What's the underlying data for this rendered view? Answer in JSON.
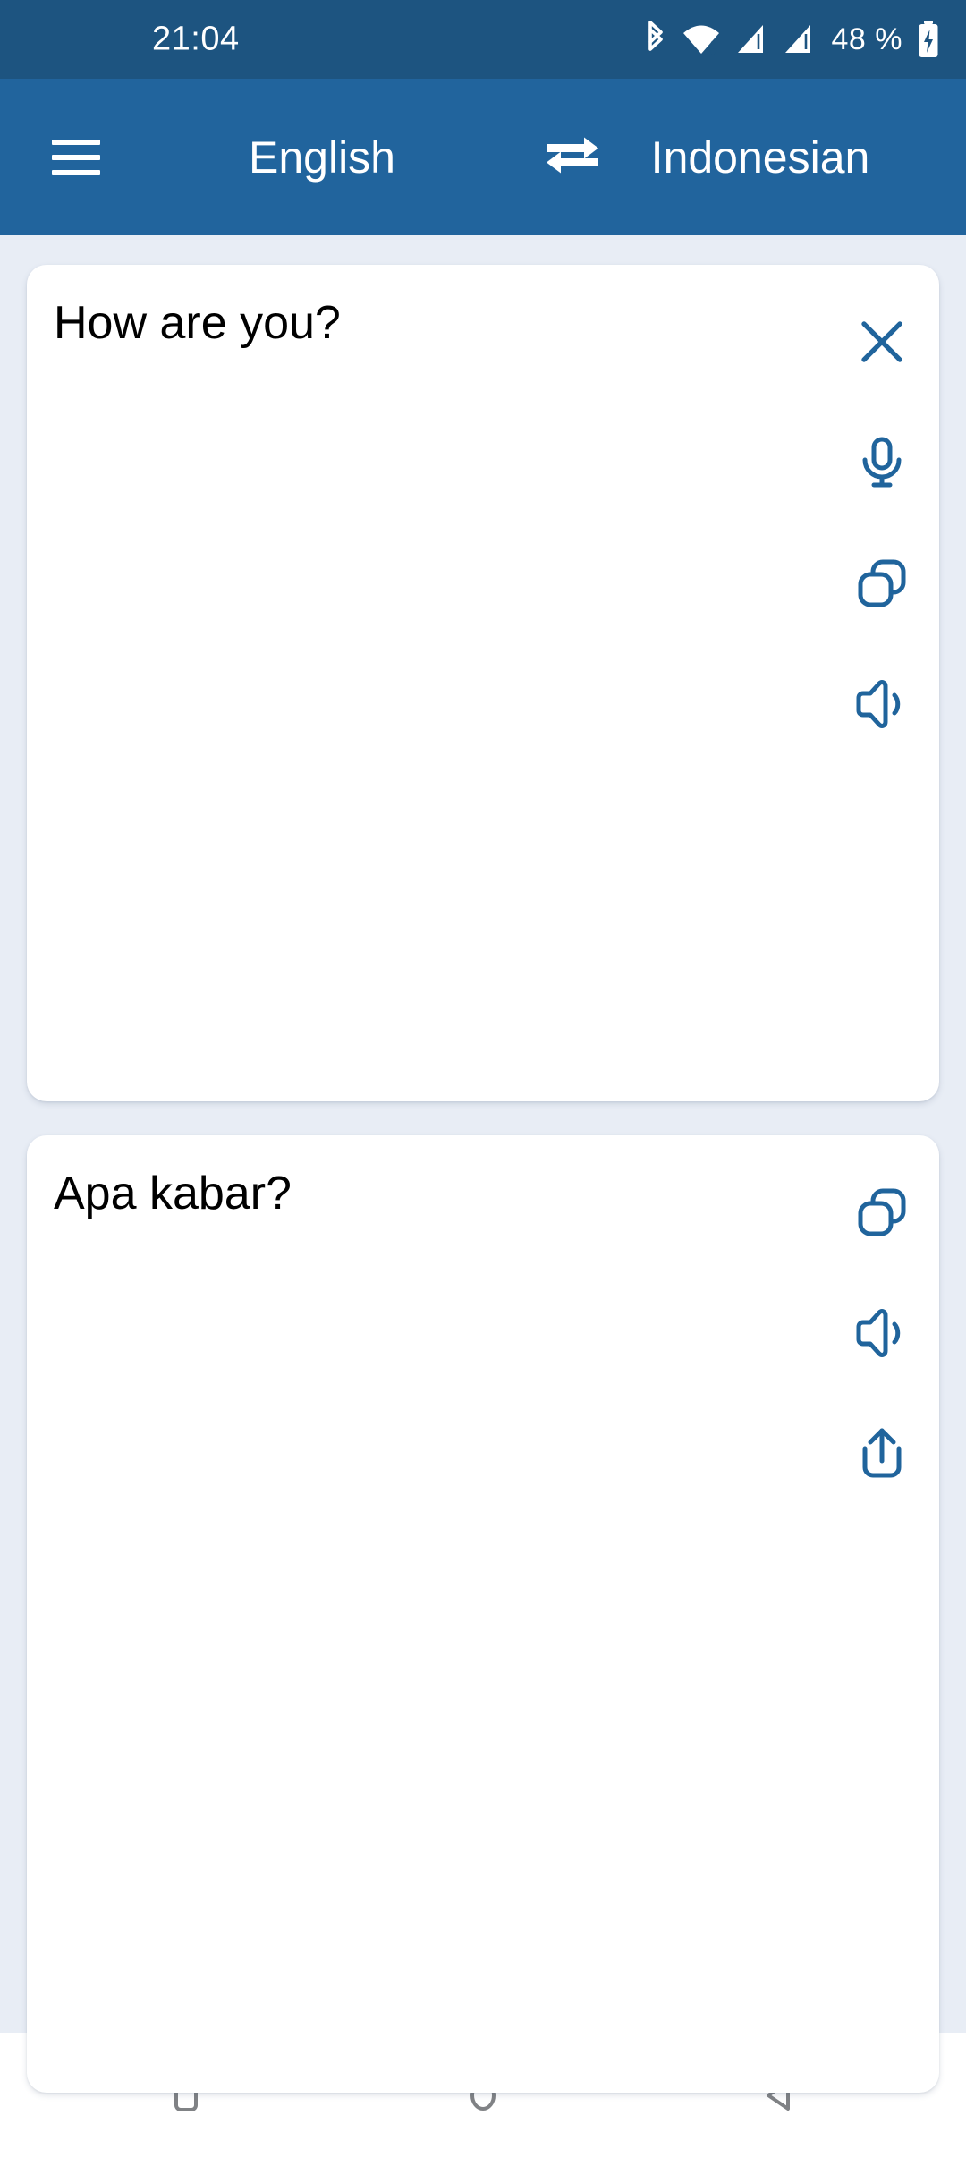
{
  "status_bar": {
    "time": "21:04",
    "battery_percent": "48 %",
    "icons": [
      "bluetooth-icon",
      "wifi-icon",
      "signal-sim1-icon",
      "signal-sim2-icon",
      "battery-charging-icon"
    ],
    "background_color": "#1d5480"
  },
  "app_bar": {
    "menu_icon": "hamburger-menu-icon",
    "source_language": "English",
    "swap_icon": "swap-horizontal-icon",
    "target_language": "Indonesian",
    "background_color": "#21649d",
    "text_color": "#ffffff"
  },
  "source_card": {
    "text": "How are you?",
    "actions": [
      {
        "name": "clear-button",
        "icon": "close-icon"
      },
      {
        "name": "voice-input-button",
        "icon": "microphone-icon"
      },
      {
        "name": "copy-button",
        "icon": "copy-icon"
      },
      {
        "name": "speak-button",
        "icon": "speaker-icon"
      }
    ]
  },
  "target_card": {
    "text": "Apa kabar?",
    "actions": [
      {
        "name": "copy-button",
        "icon": "copy-icon"
      },
      {
        "name": "speak-button",
        "icon": "speaker-icon"
      },
      {
        "name": "share-button",
        "icon": "share-icon"
      }
    ]
  },
  "nav_bar": {
    "buttons": [
      {
        "name": "recents-button",
        "icon": "square-icon"
      },
      {
        "name": "home-button",
        "icon": "circle-icon"
      },
      {
        "name": "back-button",
        "icon": "triangle-left-icon"
      }
    ],
    "background_color": "#ffffff",
    "icon_color": "#808285"
  },
  "theme": {
    "accent_color": "#20649c",
    "page_background": "#e8edf5",
    "card_background": "#ffffff",
    "text_color": "#000000"
  }
}
